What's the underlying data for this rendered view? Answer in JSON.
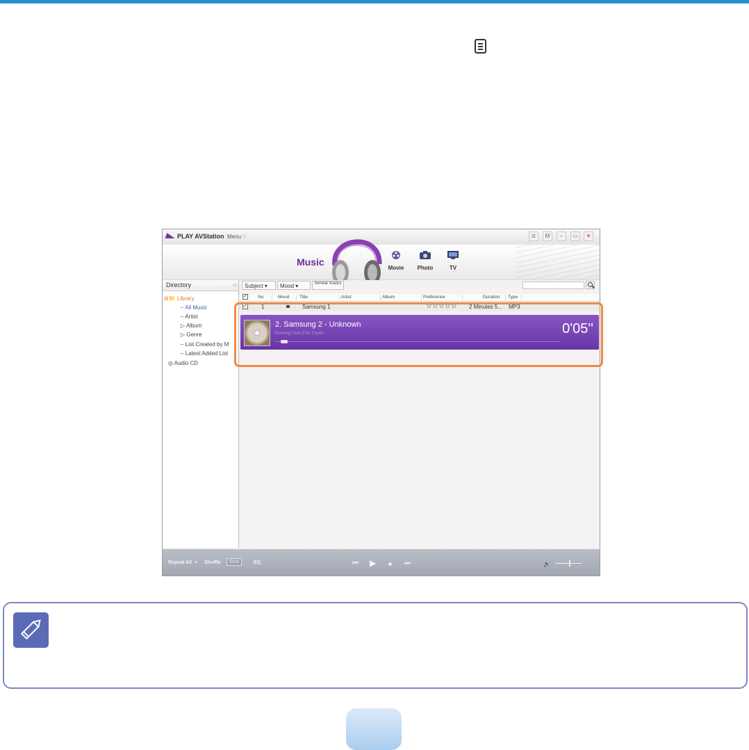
{
  "window": {
    "app_title": "PLAY AVStation",
    "menu_label": "Menu",
    "menu_chevron": "▽",
    "controls": [
      "≣",
      "M",
      "–",
      "▭",
      "✕"
    ]
  },
  "banner": {
    "section_title": "Music",
    "categories": [
      "Movie",
      "Photo",
      "TV"
    ]
  },
  "directory": {
    "header": "Directory",
    "items": [
      "Library",
      "All Music",
      "Artist",
      "Album",
      "Genre",
      "List Created by M",
      "Latest Added List",
      "Audio CD"
    ]
  },
  "toolbar": {
    "subject_label": "Subject",
    "mood_label": "Mood",
    "similar_label": "Similar tracks",
    "search_placeholder": ""
  },
  "table": {
    "columns": [
      "No",
      "Mood",
      "Title",
      "Artist",
      "Album",
      "Preference",
      "Duration",
      "Type"
    ],
    "rows": [
      {
        "no": "1",
        "title": "Samsung 1",
        "artist": "",
        "album": "",
        "preference": "☆☆☆☆☆",
        "duration": "2 Minutes 5...",
        "type": "MP3"
      }
    ]
  },
  "now_playing": {
    "track": "2.  Samsung 2 - Unknown",
    "subtext": "Running Time 2:51      Tracks",
    "time": "0'05''",
    "progress": 0.03
  },
  "bottom_bar": {
    "repeat": "Repeat All",
    "shuffle": "Shuffle",
    "eds": "EDS",
    "eq": "EQ"
  },
  "colors": {
    "accent_purple": "#6a35a6",
    "highlight_orange": "#ef8a45",
    "top_rule_blue": "#2a8fd0",
    "note_border": "#7a86c4"
  }
}
